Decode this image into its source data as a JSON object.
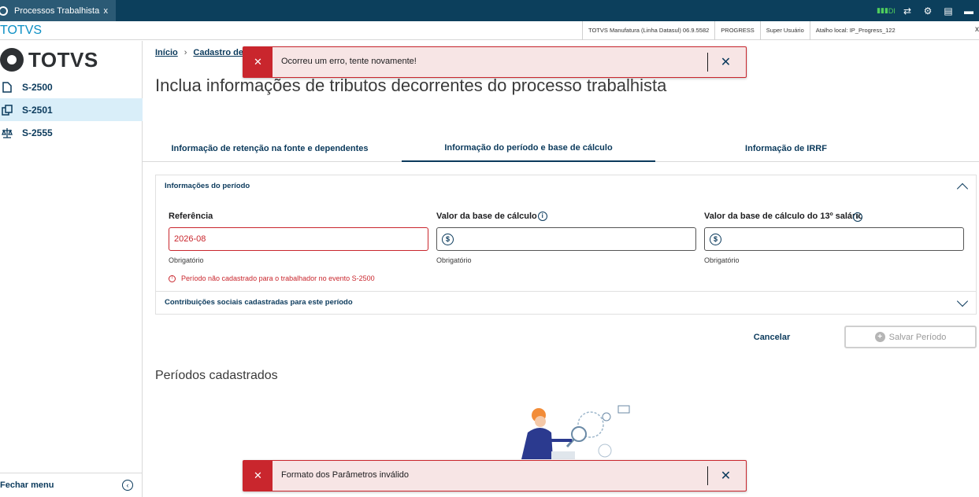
{
  "topbar": {
    "tab_title": "Processos Trabalhista",
    "tab_close": "x",
    "signal_text": "DI"
  },
  "secbar": {
    "brand": "TOTVS",
    "cells": [
      "TOTVS Manufatura (Linha Datasul) 06.9.5582",
      "PROGRESS",
      "Super Usuário",
      "Atalho local: IP_Progress_122"
    ],
    "close": "x"
  },
  "sidebar": {
    "logo_text": "TOTVS",
    "items": [
      {
        "label": "S-2500",
        "icon": "document-icon"
      },
      {
        "label": "S-2501",
        "icon": "copy-icon"
      },
      {
        "label": "S-2555",
        "icon": "scale-icon"
      }
    ],
    "footer_label": "Fechar menu"
  },
  "breadcrumb": {
    "home": "Início",
    "current": "Cadastro de"
  },
  "page": {
    "title": "Inclua informações de tributos decorrentes do processo trabalhista"
  },
  "tabs": [
    {
      "label": "Informação de retenção na fonte e dependentes"
    },
    {
      "label": "Informação do período e base de cálculo"
    },
    {
      "label": "Informação de IRRF"
    }
  ],
  "panel": {
    "header": "Informações do período",
    "fields": {
      "referencia": {
        "label": "Referência",
        "value": "2026-08",
        "help": "Obrigatório",
        "error": "Período não cadastrado para o trabalhador no evento S-2500"
      },
      "base_calculo": {
        "label": "Valor da base de cálculo",
        "value": "",
        "help": "Obrigatório",
        "currency": "$"
      },
      "base_13": {
        "label": "Valor da base de cálculo do 13º salário",
        "value": "",
        "help": "Obrigatório",
        "currency": "$"
      }
    },
    "collapsed_section": "Contribuições sociais cadastradas para este período"
  },
  "actions": {
    "cancel": "Cancelar",
    "save": "Salvar Período"
  },
  "section_title": "Períodos cadastrados",
  "toasts": [
    {
      "message": "Ocorreu um erro, tente novamente!"
    },
    {
      "message": "Formato dos Parâmetros inválido"
    }
  ],
  "colors": {
    "primary": "#0b3a5c",
    "error": "#c9262d",
    "toast_bg": "#f7e5e5",
    "topbar": "#0c3f5c"
  }
}
